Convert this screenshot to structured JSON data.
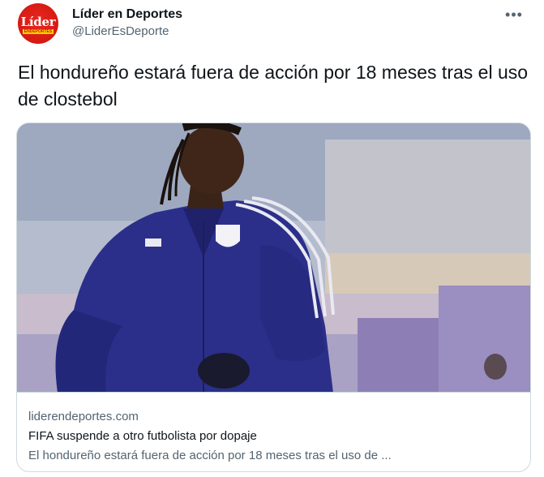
{
  "author": {
    "display_name": "Líder en Deportes",
    "handle": "@LiderEsDeporte",
    "avatar_logo": "Líder",
    "avatar_logo_sub": "ENDEPORTES",
    "brand_color": "#d51a12"
  },
  "tweet": {
    "text": "El hondureño estará fuera de acción por 18 meses tras el uso de clostebol",
    "more_icon": "more-horizontal-icon",
    "more_glyph": "•••"
  },
  "card": {
    "domain": "liderendeportes.com",
    "title": "FIFA suspende a otro futbolista por dopaje",
    "description": "El hondureño estará fuera de acción por 18 meses tras el uso de ...",
    "image": "photo of a football player in a navy blue training jacket",
    "jersey_color": "#2b2f8a"
  }
}
